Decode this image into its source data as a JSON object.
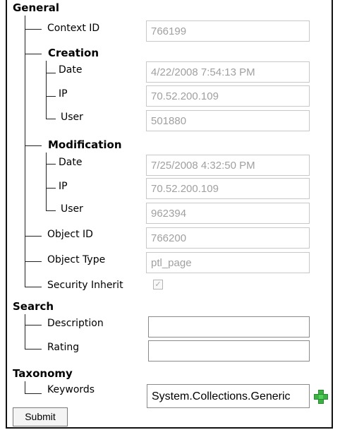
{
  "sections": {
    "general": "General",
    "search": "Search",
    "taxonomy": "Taxonomy"
  },
  "general": {
    "context_id_label": "Context ID",
    "context_id_value": "766199",
    "creation": {
      "label": "Creation",
      "date_label": "Date",
      "date_value": "4/22/2008 7:54:13 PM",
      "ip_label": "IP",
      "ip_value": "70.52.200.109",
      "user_label": "User",
      "user_value": "501880"
    },
    "modification": {
      "label": "Modification",
      "date_label": "Date",
      "date_value": "7/25/2008 4:32:50 PM",
      "ip_label": "IP",
      "ip_value": "70.52.200.109",
      "user_label": "User",
      "user_value": "962394"
    },
    "object_id_label": "Object ID",
    "object_id_value": "766200",
    "object_type_label": "Object Type",
    "object_type_value": "ptl_page",
    "security_inherit_label": "Security Inherit",
    "security_inherit_checked": true
  },
  "search": {
    "description_label": "Description",
    "description_value": "",
    "rating_label": "Rating",
    "rating_value": ""
  },
  "taxonomy": {
    "keywords_label": "Keywords",
    "keywords_value": "System.Collections.Generic"
  },
  "buttons": {
    "submit_label": "Submit",
    "add_keyword_icon": "plus-icon"
  },
  "colors": {
    "plus_green": "#3cb043",
    "disabled_text": "#a0a0a0"
  }
}
